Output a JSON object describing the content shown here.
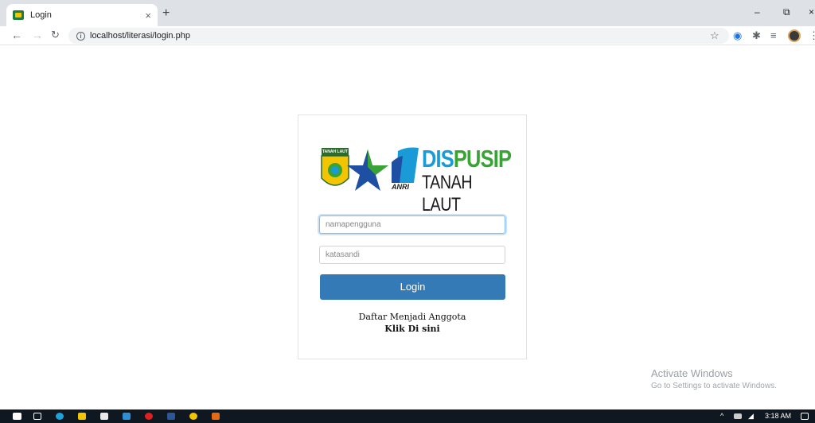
{
  "browser": {
    "tab_title": "Login",
    "tab_close": "×",
    "new_tab": "+",
    "url": "localhost/literasi/login.php",
    "win_min": "–",
    "win_restore": "⧉",
    "win_close": "×"
  },
  "logo": {
    "dis_part1": "DIS",
    "dis_part2": "PUSIP",
    "subtitle": "TANAH LAUT",
    "emblem_text": "TANAH LAUT",
    "anri": "ANRI"
  },
  "login": {
    "username_placeholder": "namapengguna",
    "password_placeholder": "katasandi",
    "button_label": "Login",
    "register_text": "Daftar Menjadi Anggota",
    "register_link": "Klik Di sini"
  },
  "watermark": {
    "line1": "Activate Windows",
    "line2": "Go to Settings to activate Windows."
  },
  "taskbar": {
    "time": "3:18 AM"
  },
  "colors": {
    "button": "#337ab7",
    "dis_blue": "#1a9ad6",
    "pusip_green": "#3aa335"
  }
}
